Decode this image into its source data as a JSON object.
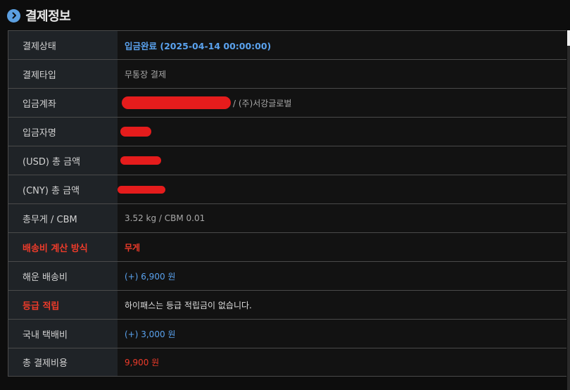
{
  "header": {
    "icon": "chevron-right-icon",
    "title": "결제정보"
  },
  "rows": [
    {
      "label": "결제상태",
      "value": "입금완료 (2025-04-14 00:00:00)"
    },
    {
      "label": "결제타입",
      "value": "무통장 결제"
    },
    {
      "label": "입금계좌",
      "value": "/ (주)서강글로벌"
    },
    {
      "label": "입금자명",
      "value": ""
    },
    {
      "label": "(USD) 총 금액",
      "value": ""
    },
    {
      "label": "(CNY) 총 금액",
      "value": ""
    },
    {
      "label": "총무게 / CBM",
      "value": "3.52 kg / CBM 0.01"
    },
    {
      "label": "배송비 계산 방식",
      "value": "무게"
    },
    {
      "label": "해운 배송비",
      "value": "(+) 6,900 원"
    },
    {
      "label": "등급 적립",
      "value": "하이패스는 등급 적립금이 없습니다."
    },
    {
      "label": "국내 택배비",
      "value": "(+) 3,000 원"
    },
    {
      "label": "총 결제비용",
      "value": "9,900 원"
    }
  ],
  "colors": {
    "accent_blue": "#5aa2ee",
    "accent_red": "#ee3b2a",
    "redaction": "#e51c1c"
  }
}
